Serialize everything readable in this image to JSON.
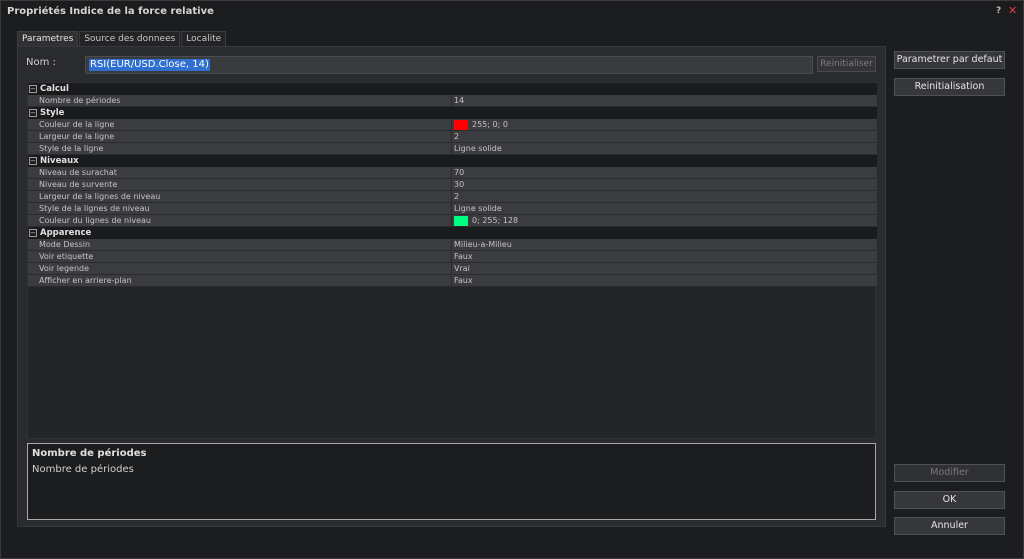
{
  "window": {
    "title": "Propriétés Indice de la force relative",
    "help": "?",
    "close": "✕"
  },
  "tabs": [
    {
      "label": "Parametres",
      "active": true
    },
    {
      "label": "Source des donnees",
      "active": false
    },
    {
      "label": "Localite",
      "active": false
    }
  ],
  "name_field": {
    "label": "Nom :",
    "value": "RSI(EUR/USD.Close, 14)",
    "reset_label": "Reinitialiser"
  },
  "properties": {
    "calcul": {
      "title": "Calcul",
      "periods": {
        "label": "Nombre de périodes",
        "value": "14"
      }
    },
    "style": {
      "title": "Style",
      "line_color": {
        "label": "Couleur de la ligne",
        "value": "255; 0; 0",
        "color": "#ff0000"
      },
      "line_width": {
        "label": "Largeur de la ligne",
        "value": "2"
      },
      "line_style": {
        "label": "Style de la ligne",
        "value": "Ligne solide"
      }
    },
    "niveaux": {
      "title": "Niveaux",
      "overbought": {
        "label": "Niveau de surachat",
        "value": "70"
      },
      "oversold": {
        "label": "Niveau de survente",
        "value": "30"
      },
      "level_width": {
        "label": "Largeur de la lignes de niveau",
        "value": "2"
      },
      "level_style": {
        "label": "Style de la lignes de niveau",
        "value": "Ligne solide"
      },
      "level_color": {
        "label": "Couleur du lignes de niveau",
        "value": "0; 255; 128",
        "color": "#00ff80"
      }
    },
    "apparence": {
      "title": "Apparence",
      "draw_mode": {
        "label": "Mode Dessin",
        "value": "Milieu-a-Milieu"
      },
      "show_label": {
        "label": "Voir etiquette",
        "value": "Faux"
      },
      "show_legend": {
        "label": "Voir legende",
        "value": "Vrai"
      },
      "background": {
        "label": "Afficher en arriere-plan",
        "value": "Faux"
      }
    }
  },
  "description": {
    "title": "Nombre de périodes",
    "text": "Nombre de périodes"
  },
  "buttons": {
    "default": "Parametrer par defaut",
    "reinit": "Reinitialisation",
    "modify": "Modifier",
    "ok": "OK",
    "cancel": "Annuler"
  },
  "collapse_glyph": "−"
}
